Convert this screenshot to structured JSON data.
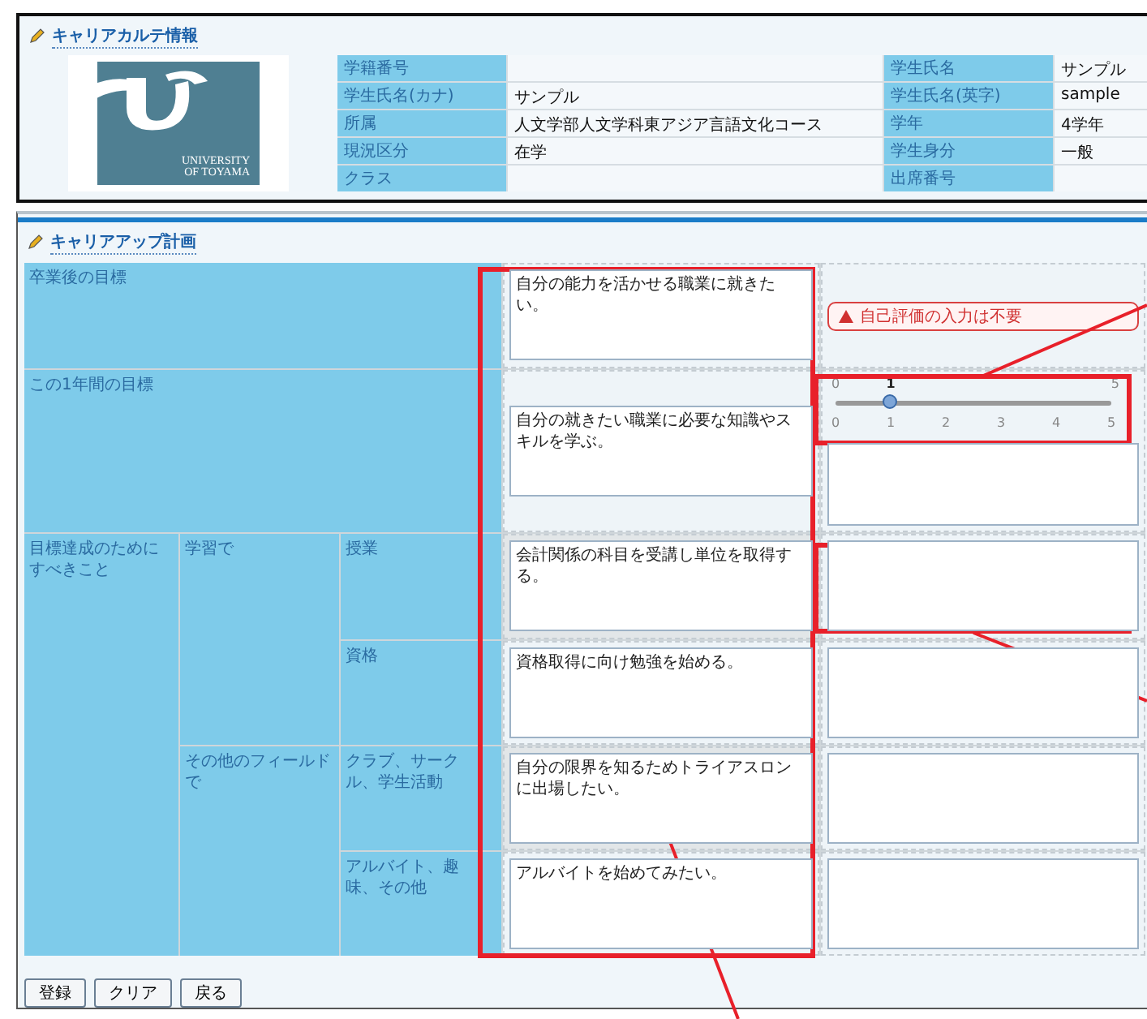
{
  "profile": {
    "title": "キャリアカルテ情報",
    "logo": {
      "lines": [
        "UNIVERSITY",
        "OF TOYAMA"
      ]
    },
    "rows": [
      {
        "left": {
          "label": "学籍番号"
        },
        "right": {
          "label": "学生氏名",
          "value": "サンプル"
        }
      },
      {
        "left": {
          "label": "学生氏名(カナ)",
          "value": "サンプル"
        },
        "right": {
          "label": "学生氏名(英字)",
          "value": "sample"
        }
      },
      {
        "left": {
          "label": "所属",
          "value": "人文学部人文学科東アジア言語文化コース"
        },
        "right": {
          "label": "学年",
          "value": "4学年"
        }
      },
      {
        "left": {
          "label": "現況区分",
          "value": "在学"
        },
        "right": {
          "label": "学生身分",
          "value": "一般"
        }
      },
      {
        "left": {
          "label": "クラス"
        },
        "right": {
          "label": "出席番号"
        }
      }
    ]
  },
  "plan": {
    "title": "キャリアアップ計画",
    "goals": [
      {
        "kind": "notice",
        "label": "卒業後の目標",
        "plan": "自分の能力を活かせる職業に就きたい。",
        "notice": "自己評価の入力は不要"
      },
      {
        "kind": "rating",
        "label": "この1年間の目標",
        "plan": "自分の就きたい職業に必要な知識やスキルを学ぶ。",
        "rating": {
          "min_label": "0",
          "max_label": "5",
          "value_label": "1",
          "ticks": [
            "0",
            "1",
            "2",
            "3",
            "4",
            "5"
          ],
          "level": 0.2
        }
      }
    ],
    "actions": {
      "label": "目標達成のためにすべきこと",
      "groups": [
        {
          "label": "学習で",
          "items": [
            {
              "label": "授業",
              "plan": "会計関係の科目を受講し単位を取得する。"
            },
            {
              "label": "資格",
              "plan": "資格取得に向け勉強を始める。"
            }
          ]
        },
        {
          "label": "その他のフィールドで",
          "items": [
            {
              "label": "クラブ、サークル、学生活動",
              "plan": "自分の限界を知るためトライアスロンに出場したい。"
            },
            {
              "label": "アルバイト、趣味、その他",
              "plan": "アルバイトを始めてみたい。"
            }
          ]
        }
      ]
    }
  },
  "buttons": [
    "登録",
    "クリア",
    "戻る"
  ]
}
